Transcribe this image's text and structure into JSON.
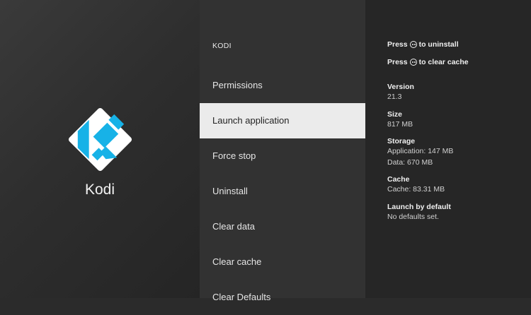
{
  "app": {
    "name": "Kodi",
    "header": "KODI",
    "logo_colors": {
      "tile": "#17B2E7",
      "outline": "#ffffff"
    }
  },
  "menu": {
    "items": [
      {
        "label": "Permissions",
        "selected": false
      },
      {
        "label": "Launch application",
        "selected": true
      },
      {
        "label": "Force stop",
        "selected": false
      },
      {
        "label": "Uninstall",
        "selected": false
      },
      {
        "label": "Clear data",
        "selected": false
      },
      {
        "label": "Clear cache",
        "selected": false
      },
      {
        "label": "Clear Defaults",
        "selected": false
      }
    ]
  },
  "hints": [
    {
      "prefix": "Press",
      "icon": "remote-menu-button-icon",
      "suffix": "to uninstall"
    },
    {
      "prefix": "Press",
      "icon": "remote-menu-button-icon",
      "suffix": "to clear cache"
    }
  ],
  "info": [
    {
      "label": "Version",
      "values": [
        "21.3"
      ]
    },
    {
      "label": "Size",
      "values": [
        "817 MB"
      ]
    },
    {
      "label": "Storage",
      "values": [
        "Application: 147 MB",
        "Data: 670 MB"
      ]
    },
    {
      "label": "Cache",
      "values": [
        "Cache: 83.31 MB"
      ]
    },
    {
      "label": "Launch by default",
      "values": [
        "No defaults set."
      ]
    }
  ]
}
